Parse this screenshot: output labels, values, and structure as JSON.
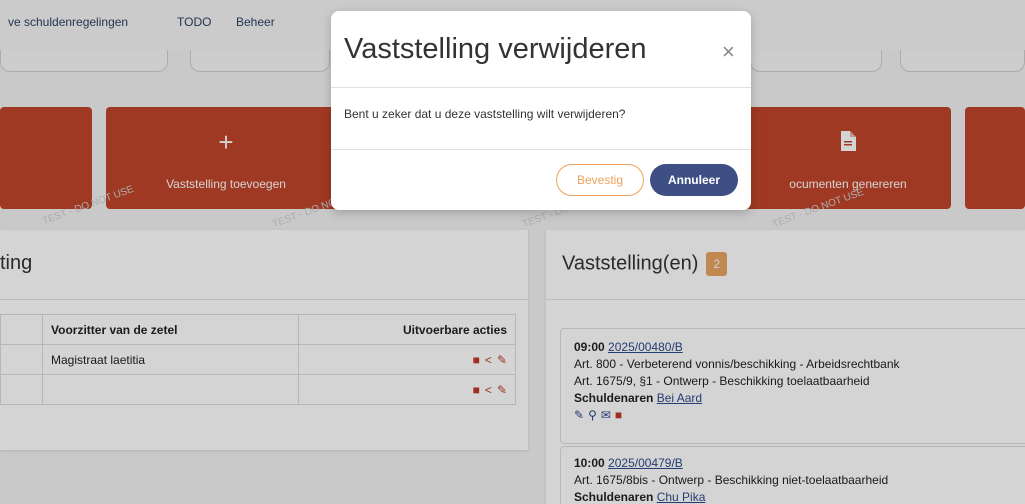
{
  "nav": {
    "items": [
      "ve schuldenregelingen",
      "TODO",
      "Beheer"
    ]
  },
  "actions": {
    "add_label": "Vaststelling toevoegen",
    "docs_label": "ocumenten genereren"
  },
  "watermark": "TEST - DO NOT USE",
  "zitting_panel": {
    "title": "ting",
    "columns": [
      "Voorzitter van de zetel",
      "Uitvoerbare acties"
    ],
    "rows": [
      {
        "voorzitter": "Magistraat laetitia"
      },
      {
        "voorzitter": ""
      }
    ]
  },
  "vaststelling_panel": {
    "title": "Vaststelling(en)",
    "count": "2",
    "cards": [
      {
        "time": "09:00",
        "dossier": "2025/00480/B",
        "lines": [
          "Art. 800 - Verbeterend vonnis/beschikking - Arbeidsrechtbank",
          "Art. 1675/9, §1 - Ontwerp - Beschikking toelaatbaarheid"
        ],
        "debtors_label": "Schuldenaren",
        "debtor": "Bei Aard"
      },
      {
        "time": "10:00",
        "dossier": "2025/00479/B",
        "lines": [
          "Art. 1675/8bis - Ontwerp - Beschikking niet-toelaatbaarheid"
        ],
        "debtors_label": "Schuldenaren",
        "debtor": "Chu Pika"
      }
    ]
  },
  "modal": {
    "title": "Vaststelling verwijderen",
    "message": "Bent u zeker dat u deze vaststelling wilt verwijderen?",
    "confirm_label": "Bevestig",
    "cancel_label": "Annuleer"
  },
  "colors": {
    "action_card": "#c0452b",
    "primary": "#3d4f85",
    "confirm_accent": "#e8a25c",
    "badge": "#e7a562"
  }
}
